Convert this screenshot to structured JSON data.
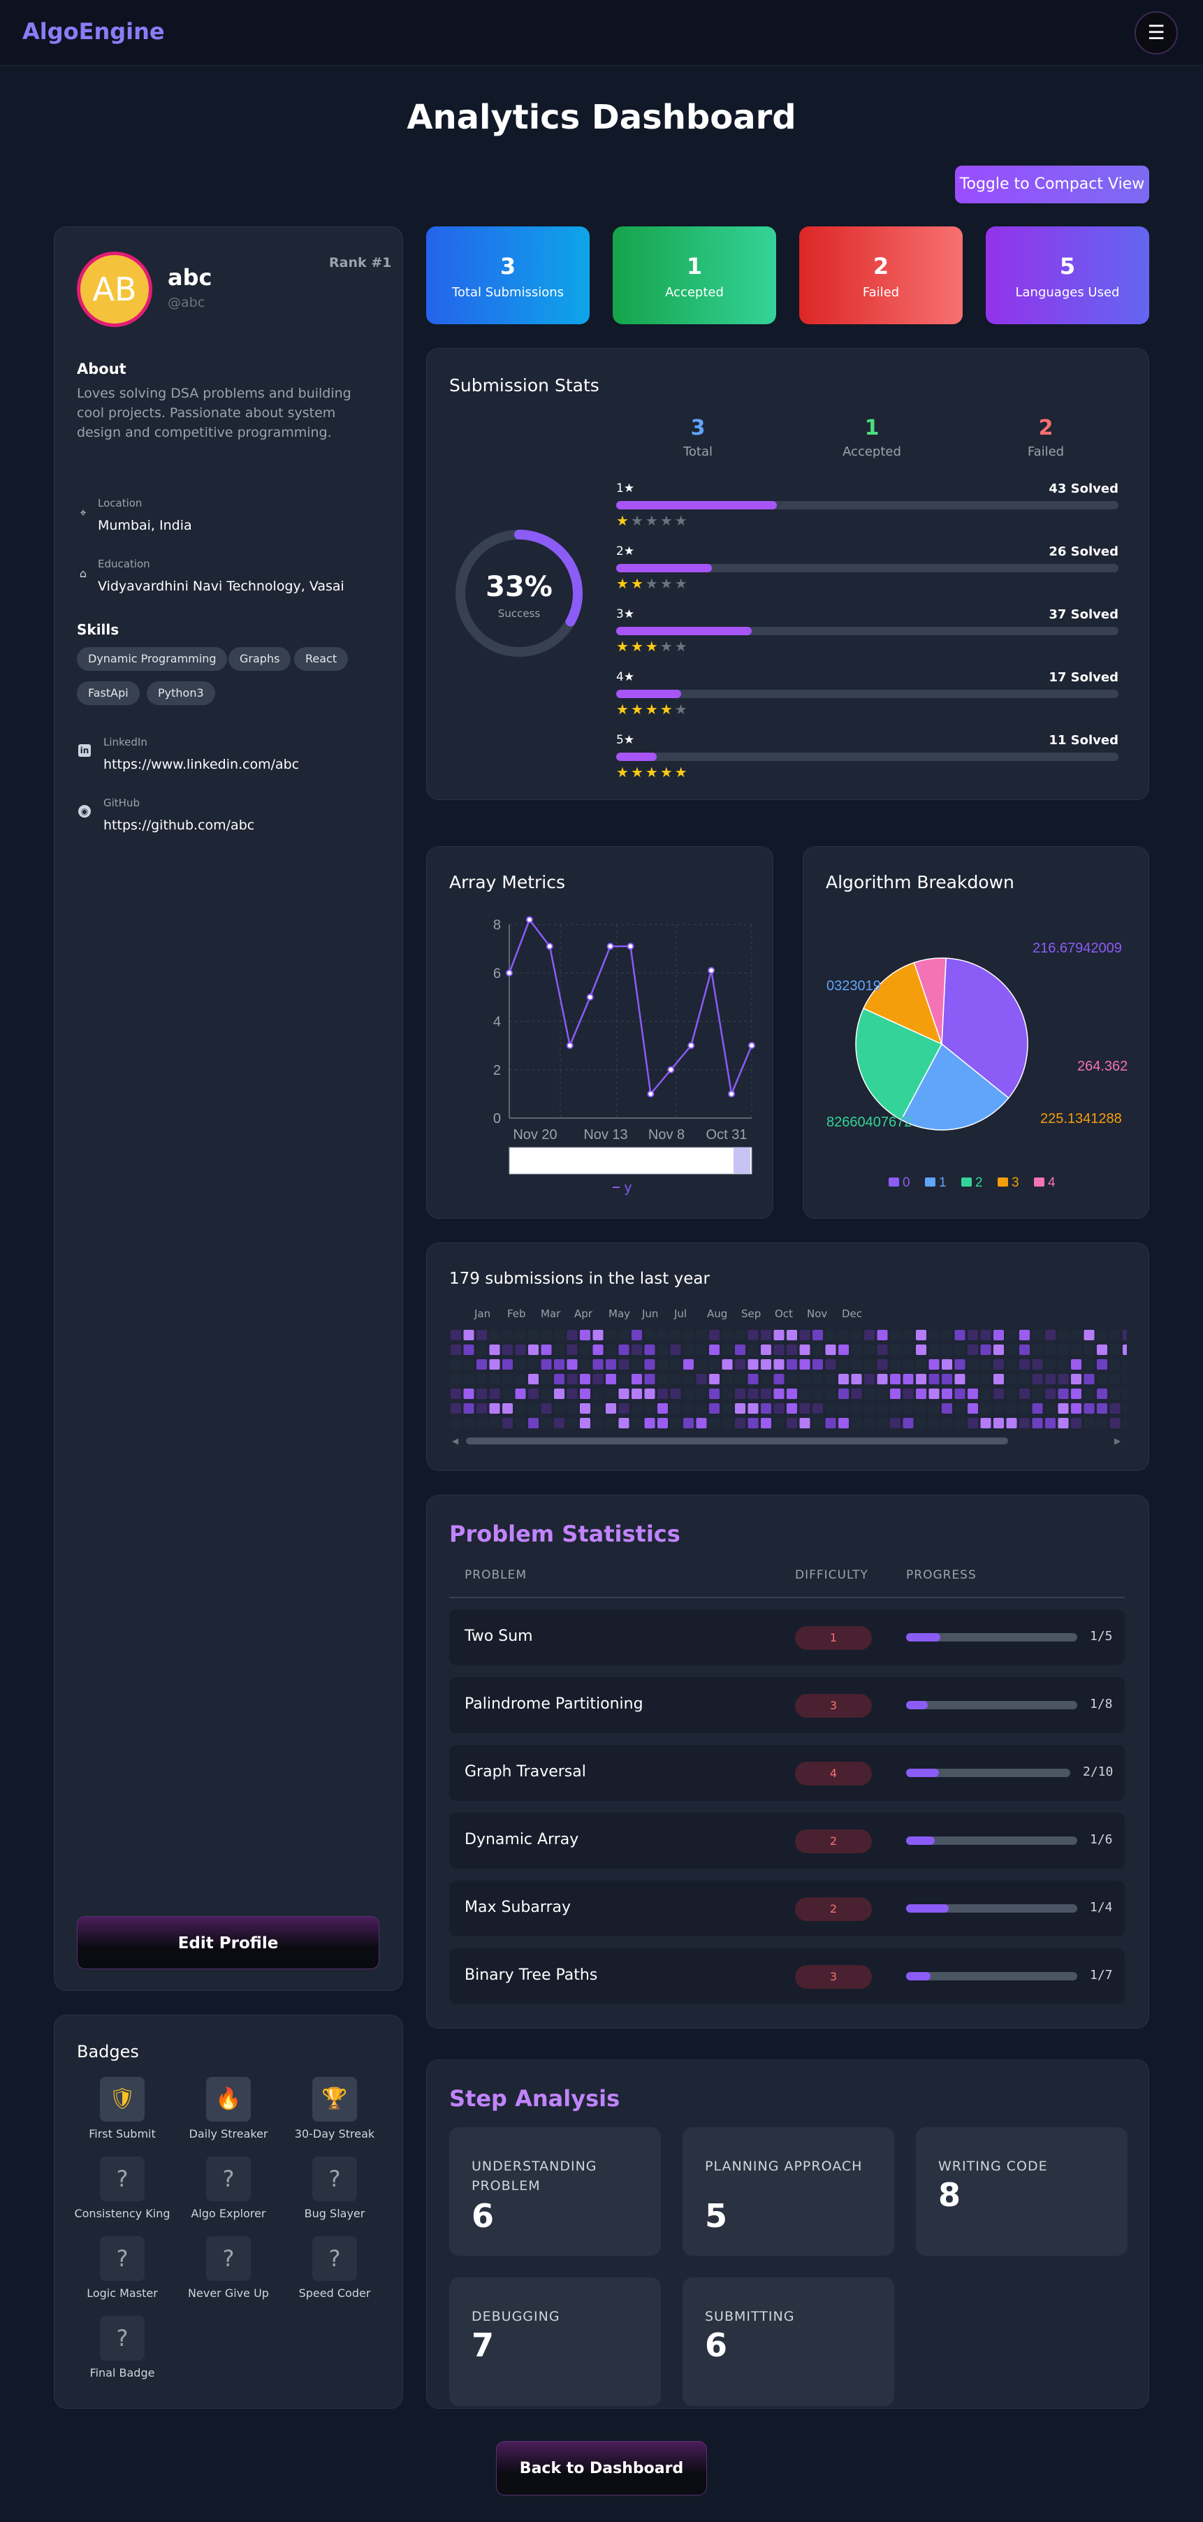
{
  "nav": {
    "brand": "AlgoEngine",
    "menu_icon": "☰"
  },
  "page_title": "Analytics Dashboard",
  "toggle_label": "Toggle to Compact View",
  "profile": {
    "initials": "AB",
    "name": "abc",
    "handle": "@abc",
    "rank": "Rank #1",
    "about_label": "About",
    "about_text": "Loves solving DSA problems and building cool projects. Passionate about system design and competitive programming.",
    "location_label": "Location",
    "location": "Mumbai, India",
    "education_label": "Education",
    "education": "Vidyavardhini Navi Technology, Vasai",
    "skills_label": "Skills",
    "skills": [
      "Dynamic Programming",
      "Graphs",
      "React",
      "FastApi",
      "Python3"
    ],
    "linkedin_label": "LinkedIn",
    "linkedin": "https://www.linkedin.com/abc",
    "github_label": "GitHub",
    "github": "https://github.com/abc",
    "edit_label": "Edit Profile"
  },
  "stats_cards": [
    {
      "value": "3",
      "label": "Total Submissions",
      "color": "#2b6fe0"
    },
    {
      "value": "1",
      "label": "Accepted",
      "color": "#16a34a"
    },
    {
      "value": "2",
      "label": "Failed",
      "color": "#dc2626"
    },
    {
      "value": "5",
      "label": "Languages Used",
      "color": "#7c3aed"
    }
  ],
  "submission_stats": {
    "title": "Submission Stats",
    "success_pct": "33%",
    "success_label": "Success",
    "success_fraction": 0.33,
    "totals": [
      {
        "value": "3",
        "label": "Total",
        "color": "#60a5fa"
      },
      {
        "value": "1",
        "label": "Accepted",
        "color": "#4ade80"
      },
      {
        "value": "2",
        "label": "Failed",
        "color": "#f87171"
      }
    ],
    "levels": [
      {
        "label": "1★",
        "solved": "43 Solved",
        "fill": 0.32,
        "stars": 1
      },
      {
        "label": "2★",
        "solved": "26 Solved",
        "fill": 0.19,
        "stars": 2
      },
      {
        "label": "3★",
        "solved": "37 Solved",
        "fill": 0.27,
        "stars": 3
      },
      {
        "label": "4★",
        "solved": "17 Solved",
        "fill": 0.13,
        "stars": 4
      },
      {
        "label": "5★",
        "solved": "11 Solved",
        "fill": 0.08,
        "stars": 5
      }
    ]
  },
  "array_metrics": {
    "title": "Array Metrics",
    "legend": "y"
  },
  "algorithm_breakdown": {
    "title": "Algorithm Breakdown",
    "labels": [
      "216.67942009",
      "0323019",
      "82660407672",
      "225.1341288",
      "264.362"
    ]
  },
  "chart_data": [
    {
      "type": "line",
      "title": "Array Metrics",
      "x_ticks": [
        "Nov 20",
        "Nov 13",
        "Nov 8",
        "Oct 31"
      ],
      "y_ticks": [
        "0",
        "2",
        "4",
        "6",
        "8"
      ],
      "ylim": [
        0,
        8
      ],
      "series": [
        {
          "name": "y",
          "values": [
            6,
            8.2,
            7.1,
            3,
            5,
            7.1,
            7.1,
            1,
            2,
            3,
            6.1,
            1,
            3
          ]
        }
      ]
    },
    {
      "type": "pie",
      "title": "Algorithm Breakdown",
      "legend": [
        "0",
        "1",
        "2",
        "3",
        "4"
      ],
      "values": [
        35,
        22,
        24,
        13,
        6
      ],
      "colors": [
        "#8b5cf6",
        "#60a5fa",
        "#34d399",
        "#f59e0b",
        "#f472b6"
      ]
    }
  ],
  "heatmap": {
    "title": "179 submissions in the last year",
    "months": [
      "Jan",
      "Feb",
      "Mar",
      "Apr",
      "May",
      "Jun",
      "Jul",
      "Aug",
      "Sep",
      "Oct",
      "Nov",
      "Dec"
    ]
  },
  "problems": {
    "title": "Problem Statistics",
    "headers": [
      "PROBLEM",
      "DIFFICULTY",
      "PROGRESS"
    ],
    "rows": [
      {
        "name": "Two Sum",
        "difficulty": "1",
        "progress": "1/5",
        "fraction": 0.2
      },
      {
        "name": "Palindrome Partitioning",
        "difficulty": "3",
        "progress": "1/8",
        "fraction": 0.125
      },
      {
        "name": "Graph Traversal",
        "difficulty": "4",
        "progress": "2/10",
        "fraction": 0.2
      },
      {
        "name": "Dynamic Array",
        "difficulty": "2",
        "progress": "1/6",
        "fraction": 0.167
      },
      {
        "name": "Max Subarray",
        "difficulty": "2",
        "progress": "1/4",
        "fraction": 0.25
      },
      {
        "name": "Binary Tree Paths",
        "difficulty": "3",
        "progress": "1/7",
        "fraction": 0.143
      }
    ]
  },
  "step_analysis": {
    "title": "Step Analysis",
    "steps": [
      {
        "label": "UNDERSTANDING PROBLEM",
        "value": "6"
      },
      {
        "label": "PLANNING APPROACH",
        "value": "5"
      },
      {
        "label": "WRITING CODE",
        "value": "8"
      },
      {
        "label": "DEBUGGING",
        "value": "7"
      },
      {
        "label": "SUBMITTING",
        "value": "6"
      }
    ]
  },
  "badges": {
    "title": "Badges",
    "items": [
      {
        "name": "First Submit",
        "locked": false
      },
      {
        "name": "Daily Streaker",
        "locked": false
      },
      {
        "name": "30-Day Streak",
        "locked": false
      },
      {
        "name": "Consistency King",
        "locked": true
      },
      {
        "name": "Algo Explorer",
        "locked": true
      },
      {
        "name": "Bug Slayer",
        "locked": true
      },
      {
        "name": "Logic Master",
        "locked": true
      },
      {
        "name": "Never Give Up",
        "locked": true
      },
      {
        "name": "Speed Coder",
        "locked": true
      },
      {
        "name": "Final Badge",
        "locked": true
      }
    ],
    "locked_glyph": "?"
  },
  "back_label": "Back to Dashboard"
}
